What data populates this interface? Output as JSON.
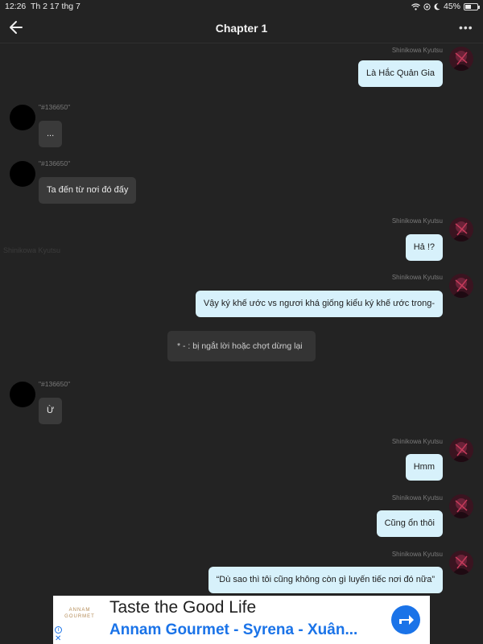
{
  "status_bar": {
    "time": "12:26",
    "date": "Th 2 17 thg 7",
    "battery": "45%",
    "battery_level": 0.45
  },
  "header": {
    "title": "Chapter 1",
    "back_icon": "arrow-left-icon",
    "more_icon": "more-horizontal-icon",
    "more_label": "•••"
  },
  "ghost_text": "Shinikowa Kyutsu",
  "messages": [
    {
      "side": "right",
      "sender": "Shinikowa  Kyutsu",
      "text": "Là Hắc Quản Gia"
    },
    {
      "side": "left",
      "sender": "\"#136650\"",
      "text": "..."
    },
    {
      "side": "left",
      "sender": "\"#136650\"",
      "text": "Ta đến từ nơi đó đấy"
    },
    {
      "side": "right",
      "sender": "Shinikowa  Kyutsu",
      "text": "Hả !?"
    },
    {
      "side": "right",
      "sender": "Shinikowa  Kyutsu",
      "text": "Vậy ký khế ước vs ngươi khá giống kiểu ký khế ước trong-"
    },
    {
      "side": "narration",
      "text": "* - : bị ngắt lời hoặc chợt dừng lại"
    },
    {
      "side": "left",
      "sender": "\"#136650\"",
      "text": "Ừ"
    },
    {
      "side": "right",
      "sender": "Shinikowa  Kyutsu",
      "text": "Hmm"
    },
    {
      "side": "right",
      "sender": "Shinikowa  Kyutsu",
      "text": "Cũng ổn thôi"
    },
    {
      "side": "right",
      "sender": "Shinikowa  Kyutsu",
      "text": "“Dù sao thì tôi cũng không còn gì luyến tiếc nơi đó nữa”"
    }
  ],
  "ad": {
    "logo_top": "ANNAM",
    "logo_bottom": "GOURMET",
    "headline": "Taste the Good Life",
    "subline": "Annam Gourmet - Syrena - Xuân...",
    "go_icon": "directions-arrow-icon",
    "info_icon": "info-icon",
    "close_icon": "close-icon",
    "close_label": "✕",
    "brand_color": "#1a73e8"
  },
  "colors": {
    "background": "#232323",
    "bubble_right": "#d7f1fb",
    "bubble_left": "#3a3a3a",
    "narration_bg": "#343434"
  }
}
